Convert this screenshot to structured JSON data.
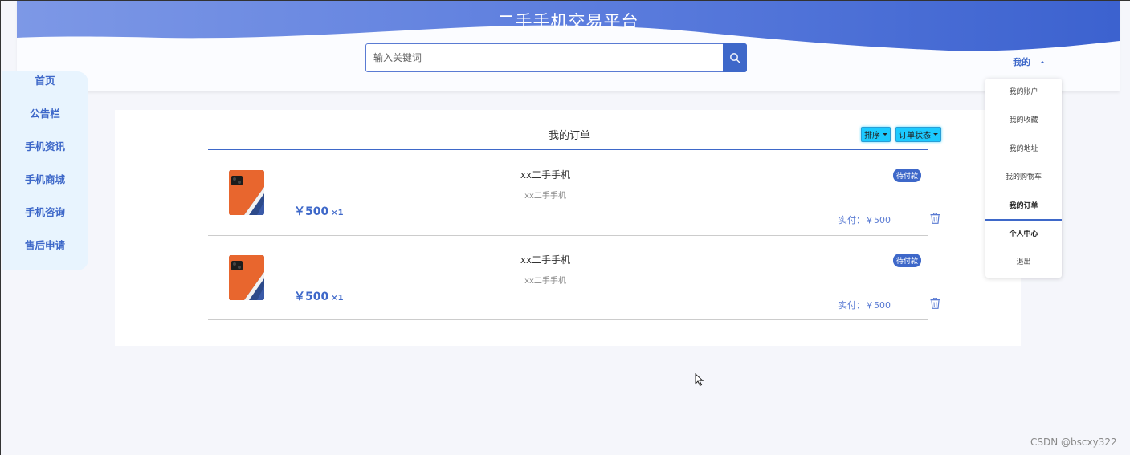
{
  "site": {
    "title": "二手手机交易平台"
  },
  "search": {
    "placeholder": "输入关键词"
  },
  "user_menu": {
    "label": "我的",
    "items": [
      "我的账户",
      "我的收藏",
      "我的地址",
      "我的购物车",
      "我的订单",
      "个人中心",
      "退出"
    ]
  },
  "nav": {
    "items": [
      "首页",
      "公告栏",
      "手机资讯",
      "手机商城",
      "手机咨询",
      "售后申请"
    ]
  },
  "orders": {
    "title": "我的订单",
    "sort_label": "排序",
    "status_filter_label": "订单状态",
    "list": [
      {
        "name": "xx二手手机",
        "desc": "xx二手手机",
        "price": "￥500",
        "qty": "×1",
        "status": "待付款",
        "paid": "实付：￥500"
      },
      {
        "name": "xx二手手机",
        "desc": "xx二手手机",
        "price": "￥500",
        "qty": "×1",
        "status": "待付款",
        "paid": "实付：￥500"
      }
    ]
  },
  "watermark": "CSDN @bscxy322",
  "colors": {
    "accent": "#3e68c9",
    "filter": "#1ccaff",
    "nav_bg": "#e8f4fe"
  }
}
